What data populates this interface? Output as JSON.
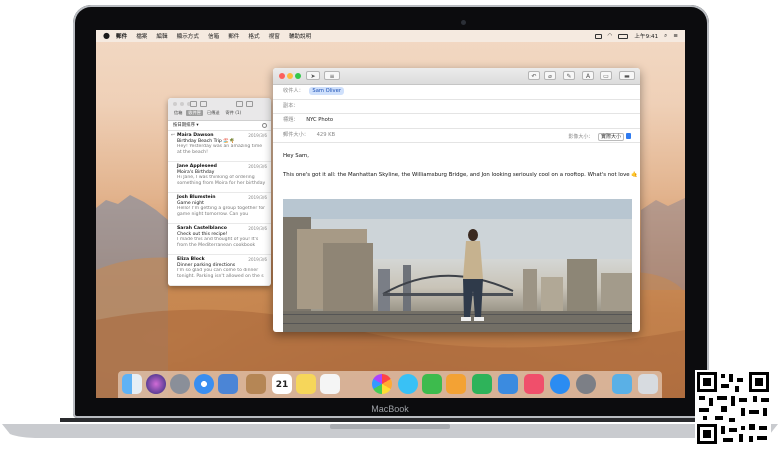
{
  "menubar": {
    "apple_icon": "apple-icon",
    "items": [
      "郵件",
      "檔案",
      "編輯",
      "顯示方式",
      "信箱",
      "郵件",
      "格式",
      "視窗",
      "輔助說明"
    ],
    "clock": "上午9:41",
    "status_icons": [
      "wifi-icon",
      "battery-icon",
      "spotlight-icon",
      "control-icon"
    ]
  },
  "viewer": {
    "tabs": [
      "信箱",
      "收件匣",
      "已傳送",
      "寄件 (1)"
    ],
    "selected_tab_index": 1,
    "sort_label": "按日期排序 ▾",
    "messages": [
      {
        "from": "Maira Dawson",
        "date": "2019/3/6",
        "subject": "Birthday Beach Trip 🏖️🌴",
        "preview": "Hey! Yesterday was an amazing time at the beach!"
      },
      {
        "from": "Jane Appleseed",
        "date": "2019/3/6",
        "subject": "Moira's Birthday",
        "preview": "Hi Jane, I was thinking of ordering something from Moira for her birthday"
      },
      {
        "from": "Josh Blumstein",
        "date": "2019/3/6",
        "subject": "Game night",
        "preview": "Hello! I'm getting a group together for game night tomorrow. Can you"
      },
      {
        "from": "Sarah Castelblanco",
        "date": "2019/3/6",
        "subject": "Check out this recipe!",
        "preview": "I made this and thought of you! It's from the Mediterranean cookbook"
      },
      {
        "from": "Eliza Block",
        "date": "2019/3/6",
        "subject": "Dinner parking directions",
        "preview": "I'm so glad you can come to dinner tonight. Parking isn't allowed on the s"
      }
    ]
  },
  "compose": {
    "to_label": "收件人：",
    "to_value": "Sam Oliver",
    "cc_label": "副本：",
    "subject_label": "標題：",
    "subject_value": "NYC Photo",
    "size_label": "郵件大小：",
    "size_value": "429 KB",
    "image_size_label": "影像大小：",
    "image_size_value": "實際大小",
    "greeting": "Hey Sam,",
    "body": "This one's got it all: the Manhattan Skyline, the Williamsburg Bridge, and Jon looking seriously cool on a rooftop. What's not love 🤙"
  },
  "dock": {
    "icons": [
      "finder-icon",
      "siri-icon",
      "launchpad-icon",
      "safari-icon",
      "mail-photo-icon",
      "notes-icon",
      "calendar-icon",
      "stickies-icon",
      "reminders-icon",
      "photos-icon",
      "messages-icon",
      "facetime-icon",
      "pages-icon",
      "numbers-icon",
      "keynote-icon",
      "music-icon",
      "app-store-icon",
      "system-preferences-icon",
      "downloads-icon",
      "trash-icon"
    ],
    "calendar_day": "21"
  },
  "device": {
    "brand": "MacBook"
  }
}
